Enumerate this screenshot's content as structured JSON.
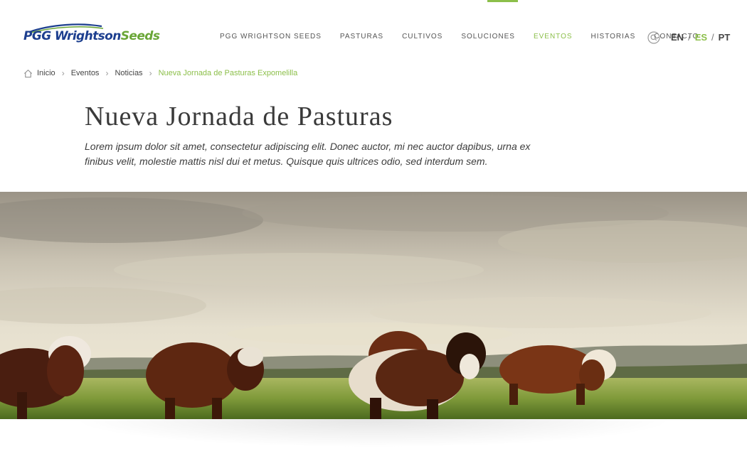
{
  "brand": {
    "logo_main": "PGG Wrightson",
    "logo_accent": "Seeds",
    "colors": {
      "primary": "#1d3f8f",
      "accent": "#8cbf4a"
    }
  },
  "nav": {
    "items": [
      {
        "label": "PGG WRIGHTSON SEEDS",
        "active": false
      },
      {
        "label": "PASTURAS",
        "active": false
      },
      {
        "label": "CULTIVOS",
        "active": false
      },
      {
        "label": "SOLUCIONES",
        "active": false
      },
      {
        "label": "EVENTOS",
        "active": true
      },
      {
        "label": "HISTORIAS",
        "active": false
      },
      {
        "label": "CONTACTO",
        "active": false
      }
    ],
    "search_icon": "search-icon"
  },
  "languages": {
    "en": "EN",
    "es": "ES",
    "pt": "PT",
    "separator": "/",
    "active": "ES"
  },
  "breadcrumb": {
    "home_icon": "home-icon",
    "items": [
      "Inicio",
      "Eventos",
      "Noticias"
    ],
    "current": "Nueva Jornada de Pasturas Expomelilla"
  },
  "article": {
    "title": "Nueva Jornada de Pasturas",
    "lead": "Lorem ipsum dolor sit amet, consectetur adipiscing elit. Donec auctor, mi nec auctor dapibus, urna ex finibus velit, molestie mattis nisl dui et metus. Quisque quis ultrices odio, sed interdum sem."
  },
  "hero": {
    "subject": "Hereford cattle grazing on pasture at sunset"
  }
}
